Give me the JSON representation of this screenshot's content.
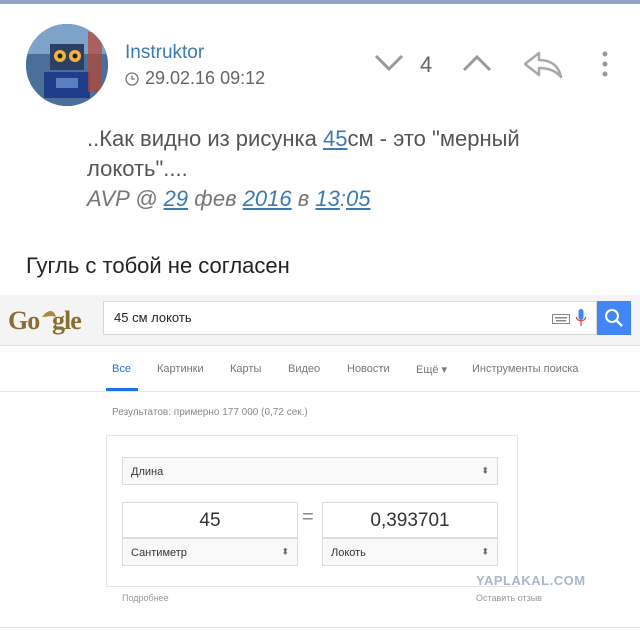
{
  "post": {
    "author": "Instruktor",
    "timestamp": "29.02.16 09:12",
    "score": "4"
  },
  "quote": {
    "prefix": "..Как видно из рисунка ",
    "link_value": "45",
    "suffix": "см - это \"мерный локоть\"....",
    "sig_author": "AVP",
    "sig_at": "@",
    "sig_day": "29",
    "sig_month": "фев",
    "sig_year": "2016",
    "sig_in": "в",
    "sig_hour": "13",
    "sig_colon": ":",
    "sig_min": "05"
  },
  "body": {
    "text": "Гугль с тобой не согласен"
  },
  "screenshot": {
    "search_query": "45 см локоть",
    "tabs": [
      "Все",
      "Картинки",
      "Карты",
      "Видео",
      "Новости",
      "Ещё ▾",
      "Инструменты поиска"
    ],
    "results_text": "Результатов: примерно 177 000 (0,72 сек.)",
    "converter": {
      "category": "Длина",
      "left_value": "45",
      "right_value": "0,393701",
      "left_unit": "Сантиметр",
      "right_unit": "Локоть",
      "equals": "="
    },
    "more": "Подробнее",
    "feedback": "Оставить отзыв",
    "watermark": "YAPLAKAL.COM"
  },
  "colors": {
    "link": "#3b7ab3",
    "google_blue": "#4285f4"
  }
}
